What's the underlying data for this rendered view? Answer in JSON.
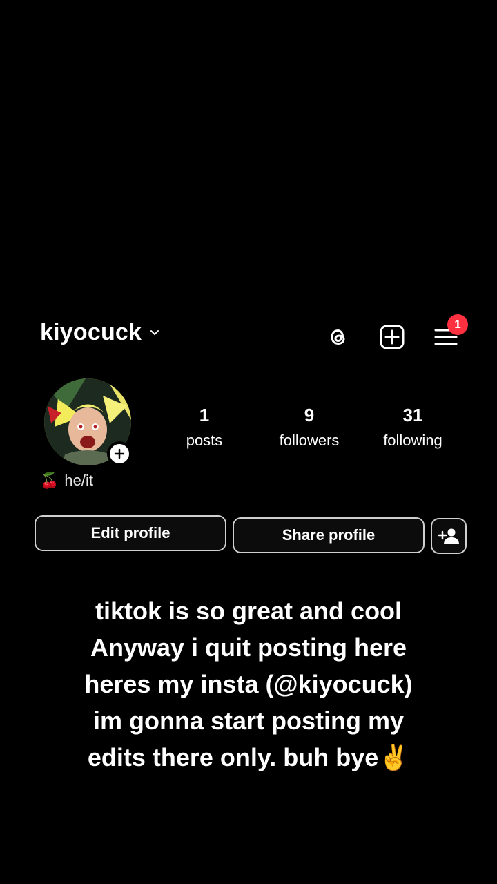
{
  "header": {
    "username": "kiyocuck",
    "notification_count": "1"
  },
  "profile": {
    "pronouns_emoji": "🍒",
    "pronouns": "he/it",
    "stats": {
      "posts_count": "1",
      "posts_label": "posts",
      "followers_count": "9",
      "followers_label": "followers",
      "following_count": "31",
      "following_label": "following"
    }
  },
  "actions": {
    "edit_label": "Edit profile",
    "share_label": "Share profile"
  },
  "caption": {
    "line1": "tiktok is so great and cool",
    "line2": "Anyway i quit posting here",
    "line3": "heres my insta (@kiyocuck)",
    "line4": "im gonna start posting my",
    "line5": "edits there only. buh bye✌️"
  },
  "colors": {
    "background": "#000000",
    "badge": "#ff3040",
    "button_border": "#cfcfcf"
  },
  "icons": [
    "chevron-down-icon",
    "threads-icon",
    "add-post-icon",
    "menu-icon",
    "plus-icon",
    "add-user-icon"
  ]
}
